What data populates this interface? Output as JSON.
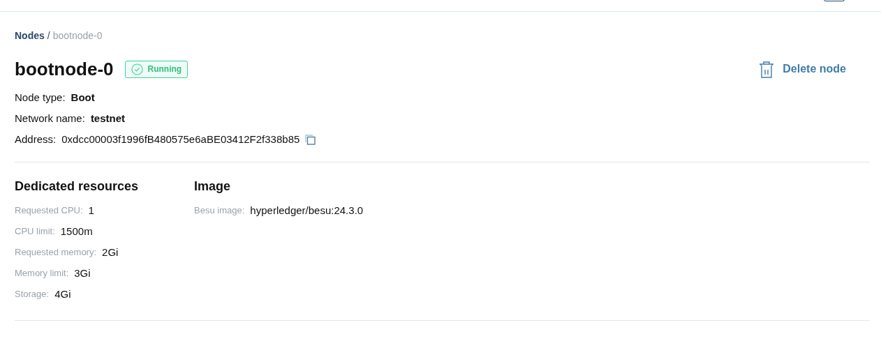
{
  "breadcrumb": [
    {
      "label": "Nodes",
      "kind": "link"
    },
    {
      "label": "/",
      "kind": "separator"
    },
    {
      "label": "bootnode-0",
      "kind": "current"
    }
  ],
  "title": "bootnode-0",
  "status": {
    "label": "Running",
    "kind": "running"
  },
  "delete_button": {
    "label": "Delete node"
  },
  "details": [
    {
      "label": "Node type:",
      "value": "Boot",
      "bold": true,
      "copyable": false
    },
    {
      "label": "Network name:",
      "value": "testnet",
      "bold": true,
      "copyable": false
    },
    {
      "label": "Address:",
      "value": "0xdcc00003f1996fB480575e6aBE03412F2f338b85",
      "bold": false,
      "copyable": true
    }
  ],
  "sections": [
    {
      "title": "Dedicated resources",
      "rows": [
        {
          "label": "Requested CPU:",
          "value": "1"
        },
        {
          "label": "CPU limit:",
          "value": "1500m"
        },
        {
          "label": "Requested memory:",
          "value": "2Gi"
        },
        {
          "label": "Memory limit:",
          "value": "3Gi"
        },
        {
          "label": "Storage:",
          "value": "4Gi"
        }
      ]
    },
    {
      "title": "Image",
      "rows": [
        {
          "label": "Besu image:",
          "value": "hyperledger/besu:24.3.0"
        }
      ]
    }
  ]
}
